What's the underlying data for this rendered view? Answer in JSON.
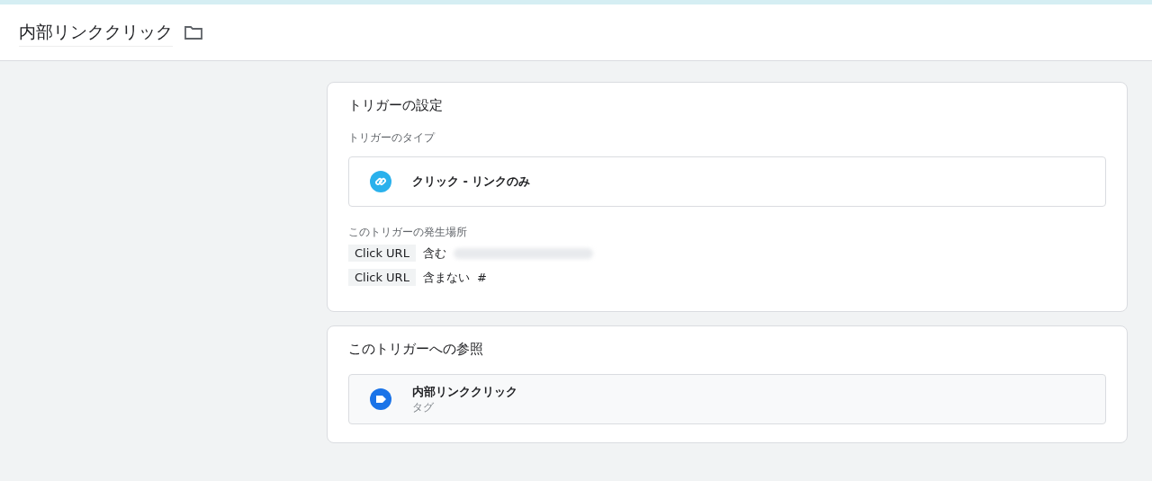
{
  "header": {
    "title": "内部リンククリック"
  },
  "trigger_settings": {
    "title": "トリガーの設定",
    "type_label": "トリガーのタイプ",
    "type_name": "クリック - リンクのみ",
    "fires_label": "このトリガーの発生場所",
    "conditions": [
      {
        "variable": "Click URL",
        "operator": "含む",
        "redacted": true
      },
      {
        "variable": "Click URL",
        "operator": "含まない",
        "value": "#",
        "redacted": false
      }
    ]
  },
  "references": {
    "title": "このトリガーへの参照",
    "items": [
      {
        "name": "内部リンククリック",
        "kind": "タグ"
      }
    ]
  }
}
